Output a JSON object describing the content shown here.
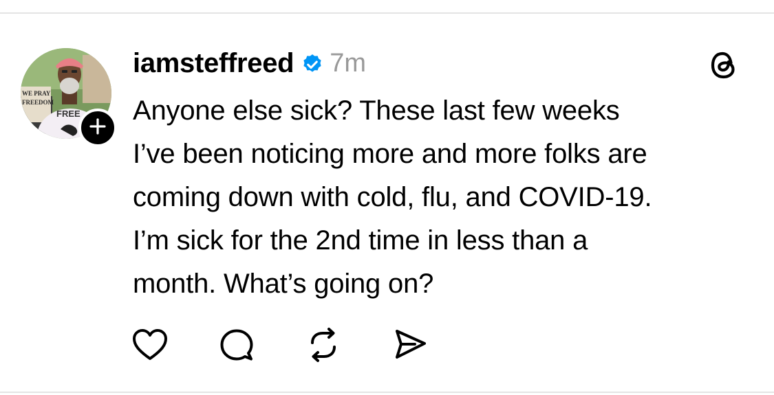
{
  "post": {
    "username": "iamsteffreed",
    "verified": true,
    "timestamp": "7m",
    "text_lines": [
      "Anyone else sick? These last few weeks",
      "I’ve been noticing more and more folks are",
      "coming down with cold, flu, and COVID-19.",
      "I’m sick for the 2nd time in less than a",
      "month. What’s going on?"
    ],
    "avatar_sign_text": [
      "WE PRAY",
      "FREEDOM"
    ],
    "avatar_shirt_text": "FREE"
  },
  "icons": {
    "follow": "plus-icon",
    "verified": "verified-badge-icon",
    "brand": "threads-logo-icon",
    "actions": [
      "heart-icon",
      "comment-icon",
      "repost-icon",
      "share-icon"
    ]
  },
  "colors": {
    "verified": "#0095f6",
    "timestamp": "#999999",
    "text": "#000000"
  }
}
